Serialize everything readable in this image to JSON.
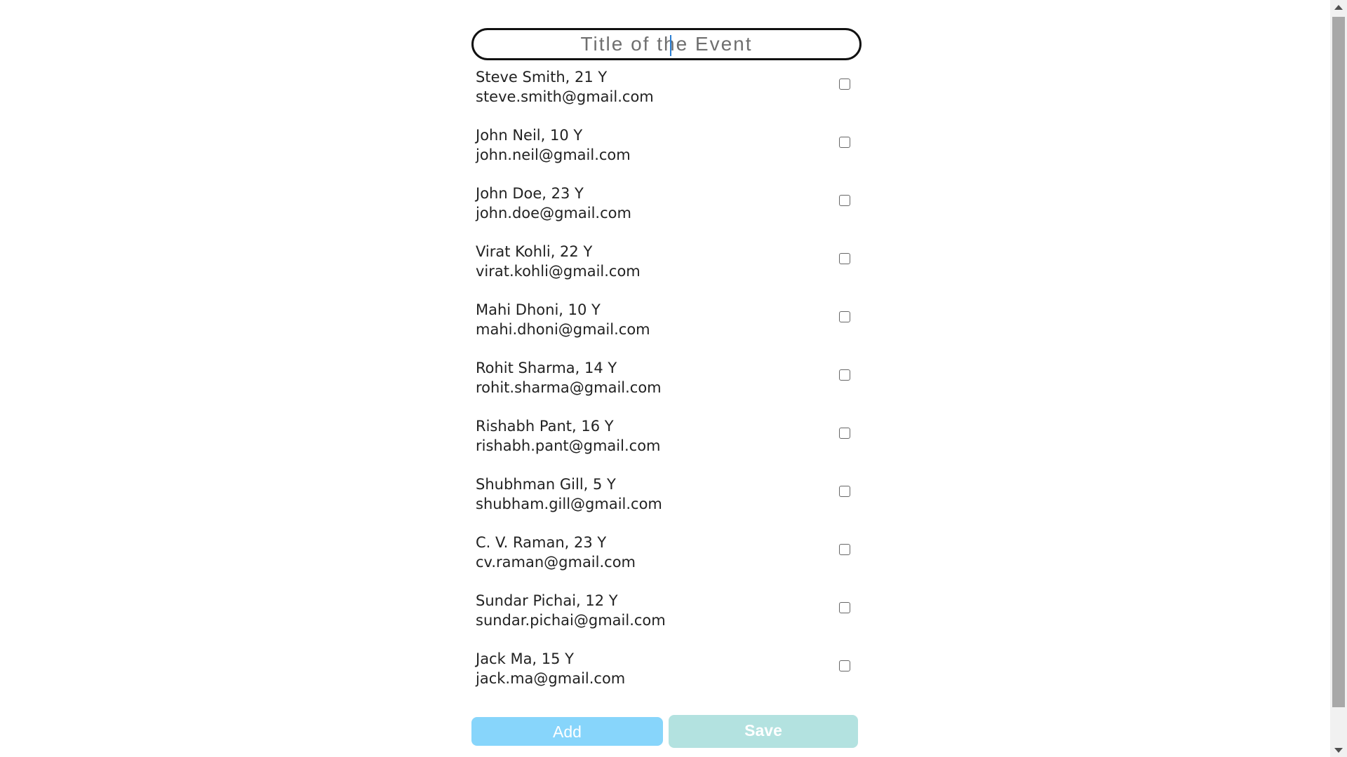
{
  "form": {
    "title_placeholder": "Title of the Event"
  },
  "people": [
    {
      "name": "Steve Smith, 21 Y",
      "email": "steve.smith@gmail.com",
      "checked": false
    },
    {
      "name": "John Neil, 10 Y",
      "email": "john.neil@gmail.com",
      "checked": false
    },
    {
      "name": "John Doe, 23 Y",
      "email": "john.doe@gmail.com",
      "checked": false
    },
    {
      "name": "Virat Kohli, 22 Y",
      "email": "virat.kohli@gmail.com",
      "checked": false
    },
    {
      "name": "Mahi Dhoni, 10 Y",
      "email": "mahi.dhoni@gmail.com",
      "checked": false
    },
    {
      "name": "Rohit Sharma, 14 Y",
      "email": "rohit.sharma@gmail.com",
      "checked": false
    },
    {
      "name": "Rishabh Pant, 16 Y",
      "email": "rishabh.pant@gmail.com",
      "checked": false
    },
    {
      "name": "Shubhman Gill, 5 Y",
      "email": "shubham.gill@gmail.com",
      "checked": false
    },
    {
      "name": "C. V. Raman, 23 Y",
      "email": "cv.raman@gmail.com",
      "checked": false
    },
    {
      "name": "Sundar Pichai, 12 Y",
      "email": "sundar.pichai@gmail.com",
      "checked": false
    },
    {
      "name": "Jack Ma, 15 Y",
      "email": "jack.ma@gmail.com",
      "checked": false
    }
  ],
  "buttons": {
    "add_label": "Add",
    "save_label": "Save"
  },
  "colors": {
    "add_button": "#87d5fb",
    "save_button": "#b3e2e0",
    "title_border": "#111111"
  }
}
